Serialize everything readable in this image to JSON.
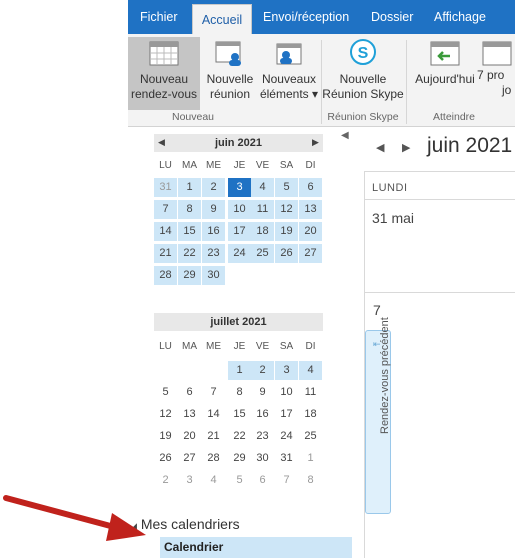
{
  "ribbon_tabs": [
    "Fichier",
    "Accueil",
    "Envoi/réception",
    "Dossier",
    "Affichage"
  ],
  "ribbon": {
    "buttons": [
      {
        "line1": "Nouveau",
        "line2": "rendez-vous"
      },
      {
        "line1": "Nouvelle",
        "line2": "réunion"
      },
      {
        "line1": "Nouveaux",
        "line2": "éléments ▾"
      },
      {
        "line1": "Nouvelle",
        "line2": "Réunion Skype"
      },
      {
        "line1": "Aujourd'hui",
        "line2": ""
      },
      {
        "line1": "7 pro",
        "line2": "jo"
      }
    ],
    "groups": [
      "Nouveau",
      "Réunion Skype",
      "Atteindre"
    ]
  },
  "day_headers": [
    "LU",
    "MA",
    "ME",
    "JE",
    "VE",
    "SA",
    "DI"
  ],
  "june": {
    "title": "juin 2021",
    "weeks": [
      [
        "31",
        "1",
        "2",
        "3",
        "4",
        "5",
        "6"
      ],
      [
        "7",
        "8",
        "9",
        "10",
        "11",
        "12",
        "13"
      ],
      [
        "14",
        "15",
        "16",
        "17",
        "18",
        "19",
        "20"
      ],
      [
        "21",
        "22",
        "23",
        "24",
        "25",
        "26",
        "27"
      ],
      [
        "28",
        "29",
        "30",
        "",
        "",
        "",
        ""
      ]
    ],
    "today": "3"
  },
  "july": {
    "title": "juillet 2021",
    "weeks": [
      [
        "",
        "",
        "",
        "1",
        "2",
        "3",
        "4"
      ],
      [
        "5",
        "6",
        "7",
        "8",
        "9",
        "10",
        "11"
      ],
      [
        "12",
        "13",
        "14",
        "15",
        "16",
        "17",
        "18"
      ],
      [
        "19",
        "20",
        "21",
        "22",
        "23",
        "24",
        "25"
      ],
      [
        "26",
        "27",
        "28",
        "29",
        "30",
        "31",
        "1"
      ],
      [
        "2",
        "3",
        "4",
        "5",
        "6",
        "7",
        "8"
      ]
    ]
  },
  "folders": {
    "group_label": "Mes calendriers",
    "calendar_label": "Calendrier"
  },
  "main": {
    "month_title": "juin 2021",
    "day_column": "LUNDI",
    "cell1_label": "31 mai",
    "cell2_label": "7",
    "peek_label": "Rendez-vous précédent"
  },
  "colors": {
    "accent": "#1f72c4",
    "highlight": "#cde6f7",
    "arrow": "#c0221c"
  }
}
